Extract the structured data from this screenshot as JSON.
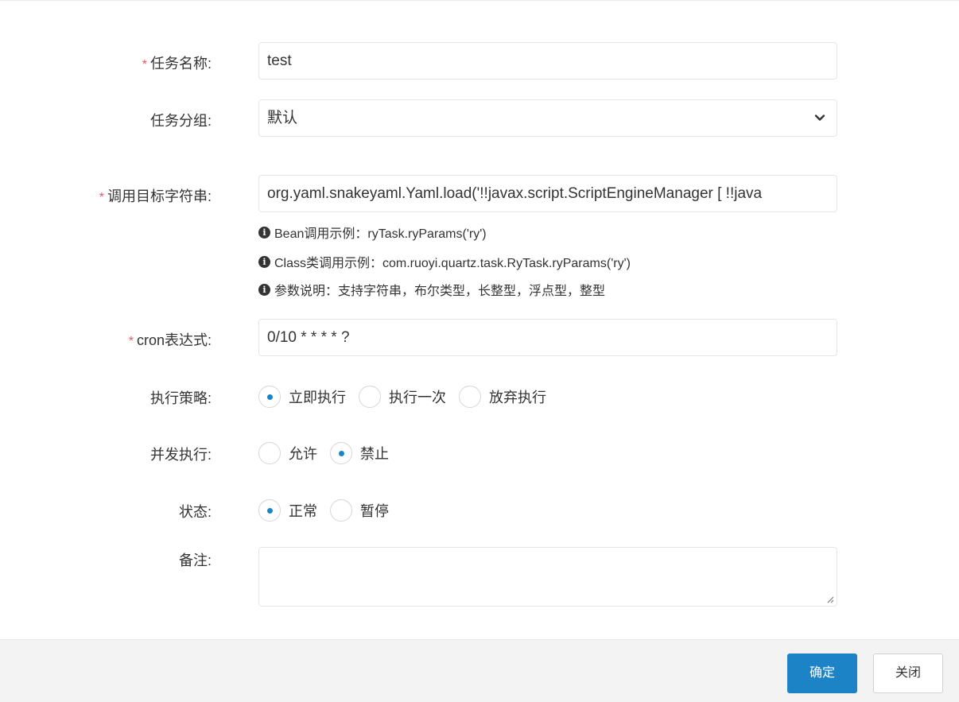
{
  "form": {
    "task_name": {
      "required": "*",
      "label": "任务名称:",
      "value": "test"
    },
    "task_group": {
      "label": "任务分组:",
      "selected": "默认"
    },
    "invoke_target": {
      "required": "*",
      "label": "调用目标字符串:",
      "value": "org.yaml.snakeyaml.Yaml.load('!!javax.script.ScriptEngineManager [   !!java",
      "help": [
        "Bean调用示例：ryTask.ryParams('ry')",
        "Class类调用示例：com.ruoyi.quartz.task.RyTask.ryParams('ry')",
        "参数说明：支持字符串，布尔类型，长整型，浮点型，整型"
      ]
    },
    "cron": {
      "required": "*",
      "label": "cron表达式:",
      "value": "0/10 * * * * ?"
    },
    "misfire_policy": {
      "label": "执行策略:",
      "options": [
        "立即执行",
        "执行一次",
        "放弃执行"
      ],
      "selected_index": 0
    },
    "concurrent": {
      "label": "并发执行:",
      "options": [
        "允许",
        "禁止"
      ],
      "selected_index": 1
    },
    "status": {
      "label": "状态:",
      "options": [
        "正常",
        "暂停"
      ],
      "selected_index": 0
    },
    "remark": {
      "label": "备注:",
      "value": ""
    }
  },
  "footer": {
    "confirm_label": "确定",
    "close_label": "关闭"
  },
  "colors": {
    "primary": "#1c84c6",
    "required": "#ed5565",
    "footer_bg": "#f3f3f4"
  },
  "icons": [
    "info-icon",
    "chevron-down-icon",
    "resize-handle-icon"
  ]
}
